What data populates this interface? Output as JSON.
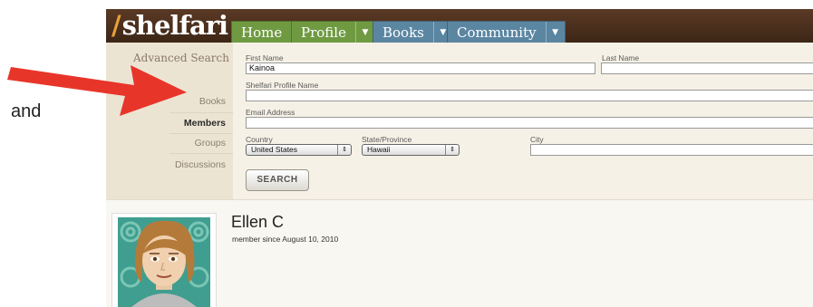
{
  "annotation": {
    "word": "and",
    "arrow_color": "#e8352a"
  },
  "brand": {
    "slash": "/",
    "name": "shelfari"
  },
  "nav": {
    "home": "Home",
    "profile": "Profile",
    "books": "Books",
    "community": "Community"
  },
  "sidebar": {
    "title": "Advanced Search",
    "items": [
      {
        "label": "Books"
      },
      {
        "label": "Members"
      },
      {
        "label": "Groups"
      },
      {
        "label": "Discussions"
      }
    ]
  },
  "form": {
    "first_name_label": "First Name",
    "first_name_value": "Kainoa",
    "last_name_label": "Last Name",
    "last_name_value": "",
    "profile_name_label": "Shelfari Profile Name",
    "profile_name_value": "",
    "email_label": "Email Address",
    "email_value": "",
    "country_label": "Country",
    "country_value": "United States",
    "state_label": "State/Province",
    "state_value": "Hawaii",
    "city_label": "City",
    "city_value": "",
    "search_button": "SEARCH"
  },
  "result": {
    "name": "Ellen C",
    "member_since": "member since August 10, 2010"
  },
  "colors": {
    "nav_green": "#6f9a42",
    "nav_blue": "#5b86a2",
    "topbar": "#4a2f1d"
  }
}
